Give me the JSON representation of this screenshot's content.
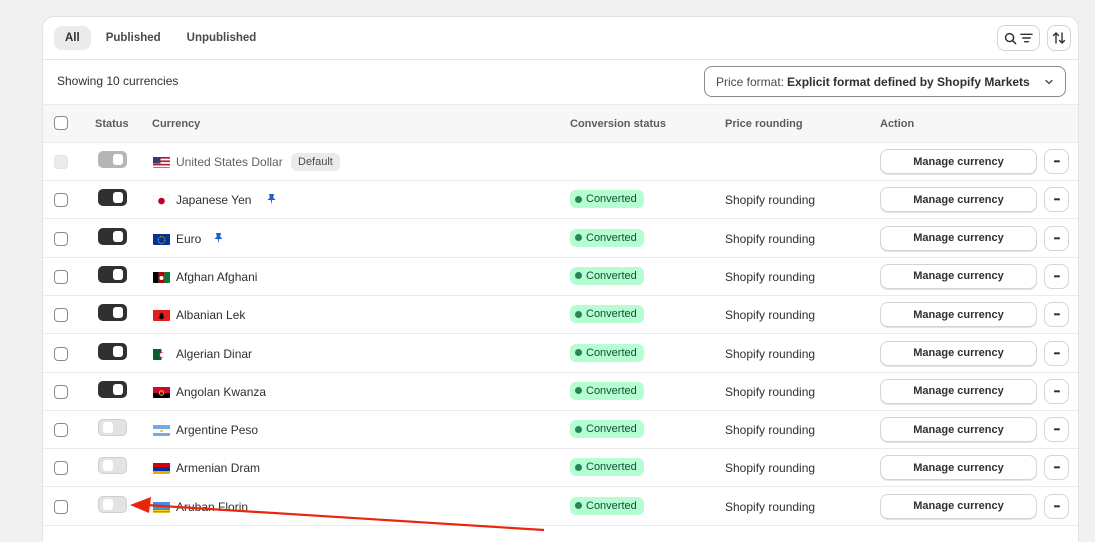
{
  "tabs": [
    {
      "label": "All",
      "active": true
    },
    {
      "label": "Published",
      "active": false
    },
    {
      "label": "Unpublished",
      "active": false
    }
  ],
  "toolbar": {
    "showing": "Showing 10 currencies",
    "price_format_label": "Price format:",
    "price_format_value": "Explicit format defined by Shopify Markets"
  },
  "columns": {
    "status": "Status",
    "currency": "Currency",
    "conversion": "Conversion status",
    "rounding": "Price rounding",
    "action": "Action"
  },
  "rows": [
    {
      "currency": "United States Dollar",
      "flag": "us",
      "badge": "Default",
      "enabled": true,
      "locked": true,
      "conversion": "",
      "rounding": "",
      "action": "Manage currency",
      "pinned": false
    },
    {
      "currency": "Japanese Yen",
      "flag": "jp",
      "badge": "",
      "enabled": true,
      "locked": false,
      "conversion": "Converted",
      "rounding": "Shopify rounding",
      "action": "Manage currency",
      "pinned": true
    },
    {
      "currency": "Euro",
      "flag": "eu",
      "badge": "",
      "enabled": true,
      "locked": false,
      "conversion": "Converted",
      "rounding": "Shopify rounding",
      "action": "Manage currency",
      "pinned": true
    },
    {
      "currency": "Afghan Afghani",
      "flag": "af",
      "badge": "",
      "enabled": true,
      "locked": false,
      "conversion": "Converted",
      "rounding": "Shopify rounding",
      "action": "Manage currency",
      "pinned": false
    },
    {
      "currency": "Albanian Lek",
      "flag": "al",
      "badge": "",
      "enabled": true,
      "locked": false,
      "conversion": "Converted",
      "rounding": "Shopify rounding",
      "action": "Manage currency",
      "pinned": false
    },
    {
      "currency": "Algerian Dinar",
      "flag": "dz",
      "badge": "",
      "enabled": true,
      "locked": false,
      "conversion": "Converted",
      "rounding": "Shopify rounding",
      "action": "Manage currency",
      "pinned": false
    },
    {
      "currency": "Angolan Kwanza",
      "flag": "ao",
      "badge": "",
      "enabled": true,
      "locked": false,
      "conversion": "Converted",
      "rounding": "Shopify rounding",
      "action": "Manage currency",
      "pinned": false
    },
    {
      "currency": "Argentine Peso",
      "flag": "ar",
      "badge": "",
      "enabled": false,
      "locked": false,
      "conversion": "Converted",
      "rounding": "Shopify rounding",
      "action": "Manage currency",
      "pinned": false
    },
    {
      "currency": "Armenian Dram",
      "flag": "am",
      "badge": "",
      "enabled": false,
      "locked": false,
      "conversion": "Converted",
      "rounding": "Shopify rounding",
      "action": "Manage currency",
      "pinned": false
    },
    {
      "currency": "Aruban Florin",
      "flag": "aw",
      "badge": "",
      "enabled": false,
      "locked": false,
      "conversion": "Converted",
      "rounding": "Shopify rounding",
      "action": "Manage currency",
      "pinned": false
    }
  ],
  "icons": {
    "search": "search-icon",
    "filter": "filter-icon",
    "sort": "sort-icon",
    "chevron": "chevron-down-icon",
    "pin": "pin-icon",
    "more": "more-horizontal-icon"
  },
  "colors": {
    "toggle_on": "#303030",
    "converted_bg": "#b4fed2",
    "converted_dot": "#29845a",
    "pin": "#1f5fd6",
    "annotation_arrow": "#e8260e"
  }
}
